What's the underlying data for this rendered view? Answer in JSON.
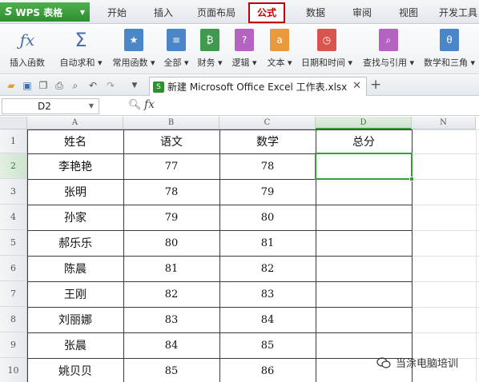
{
  "app": {
    "title": "WPS 表格",
    "logo": "S"
  },
  "menu": {
    "tabs": [
      {
        "label": "开始"
      },
      {
        "label": "插入"
      },
      {
        "label": "页面布局"
      },
      {
        "label": "公式",
        "active": true
      },
      {
        "label": "数据"
      },
      {
        "label": "审阅"
      },
      {
        "label": "视图"
      },
      {
        "label": "开发工具"
      }
    ]
  },
  "ribbon": {
    "buttons": [
      {
        "label": "插入函数",
        "icon": "fx-icon"
      },
      {
        "label": "自动求和",
        "icon": "sigma-icon",
        "dropdown": true
      },
      {
        "label": "常用函数",
        "icon": "star-icon",
        "dropdown": true
      },
      {
        "label": "全部",
        "icon": "list-icon",
        "dropdown": true
      },
      {
        "label": "财务",
        "icon": "finance-icon",
        "dropdown": true
      },
      {
        "label": "逻辑",
        "icon": "question-icon",
        "dropdown": true
      },
      {
        "label": "文本",
        "icon": "text-icon",
        "dropdown": true
      },
      {
        "label": "日期和时间",
        "icon": "clock-icon",
        "dropdown": true
      },
      {
        "label": "查找与引用",
        "icon": "lookup-icon",
        "dropdown": true
      },
      {
        "label": "数学和三角",
        "icon": "math-icon",
        "dropdown": true
      }
    ],
    "colors": {
      "star": "#4a86c8",
      "list": "#4a86c8",
      "finance": "#3f9a4f",
      "question": "#b463c0",
      "text": "#e99a3c",
      "clock": "#d9534f",
      "lookup": "#b463c0",
      "math": "#4a86c8"
    }
  },
  "doc_tab": {
    "icon_text": "S",
    "name": "新建 Microsoft Office Excel 工作表.xlsx"
  },
  "formula_bar": {
    "cell_ref": "D2",
    "fx": "fx"
  },
  "sheet": {
    "columns": [
      "A",
      "B",
      "C",
      "D",
      "N"
    ],
    "selected_column": "D",
    "selected_row": "2",
    "rows": [
      "1",
      "2",
      "3",
      "4",
      "5",
      "6",
      "7",
      "8",
      "9",
      "10"
    ],
    "headers": [
      "姓名",
      "语文",
      "数学",
      "总分"
    ],
    "data": [
      {
        "name": "李艳艳",
        "chinese": "77",
        "math": "78",
        "total": ""
      },
      {
        "name": "张明",
        "chinese": "78",
        "math": "79",
        "total": ""
      },
      {
        "name": "孙家",
        "chinese": "79",
        "math": "80",
        "total": ""
      },
      {
        "name": "郝乐乐",
        "chinese": "80",
        "math": "81",
        "total": ""
      },
      {
        "name": "陈晨",
        "chinese": "81",
        "math": "82",
        "total": ""
      },
      {
        "name": "王刚",
        "chinese": "82",
        "math": "83",
        "total": ""
      },
      {
        "name": "刘丽娜",
        "chinese": "83",
        "math": "84",
        "total": ""
      },
      {
        "name": "张晨",
        "chinese": "84",
        "math": "85",
        "total": ""
      },
      {
        "name": "姚贝贝",
        "chinese": "85",
        "math": "86",
        "total": ""
      }
    ]
  },
  "watermark": {
    "text": "当涂电脑培训"
  },
  "accent": {
    "green": "#3a9a3a",
    "highlight": "#c00000"
  }
}
